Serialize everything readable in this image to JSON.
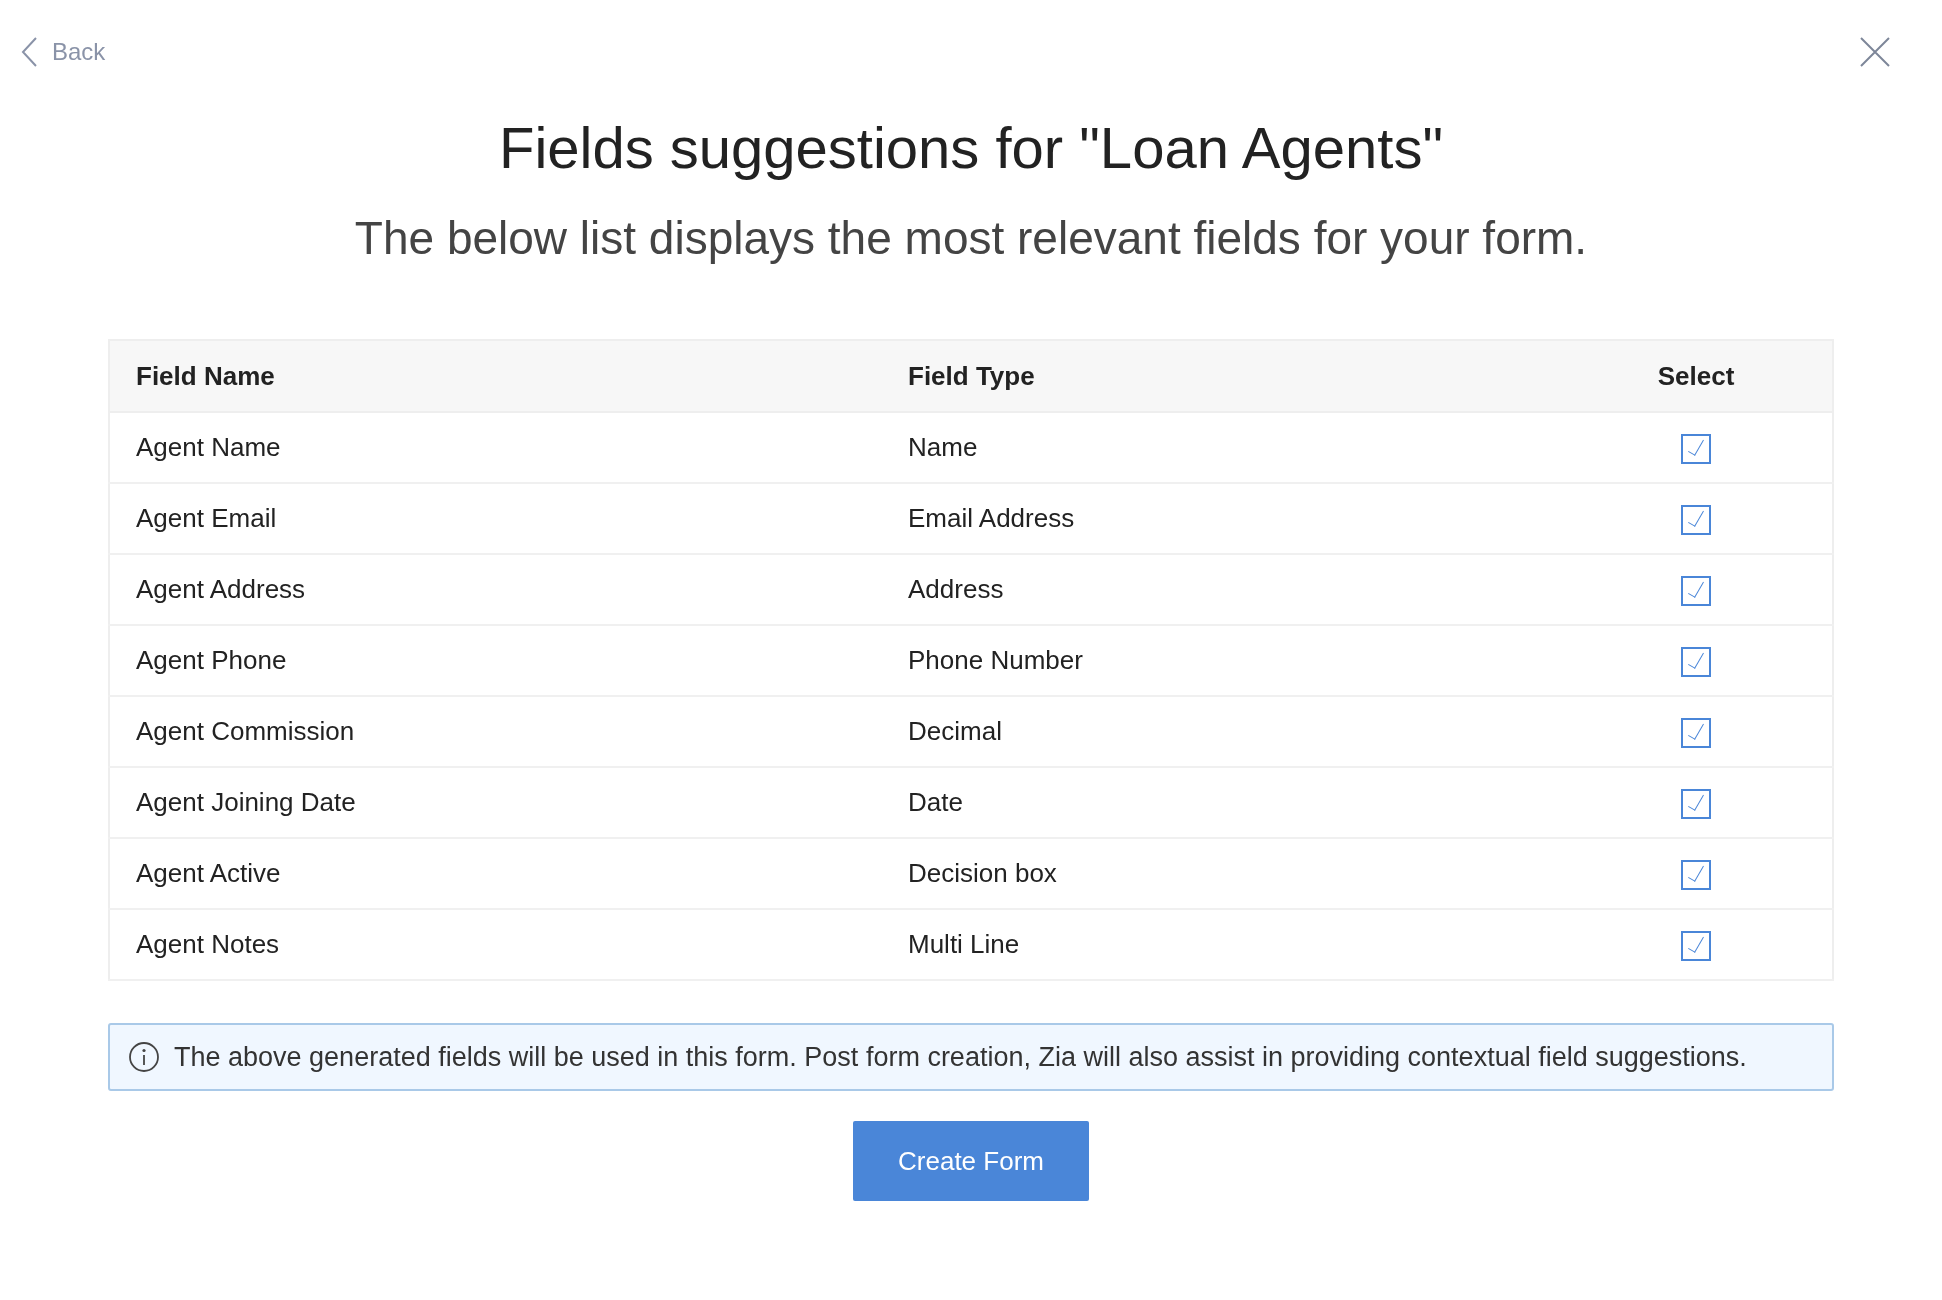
{
  "back": {
    "label": "Back"
  },
  "title": "Fields suggestions for \"Loan Agents\"",
  "subtitle": "The below list displays the most relevant fields for your form.",
  "table": {
    "columns": [
      "Field Name",
      "Field Type",
      "Select"
    ],
    "rows": [
      {
        "name": "Agent Name",
        "type": "Name",
        "checked": true
      },
      {
        "name": "Agent Email",
        "type": "Email Address",
        "checked": true
      },
      {
        "name": "Agent Address",
        "type": "Address",
        "checked": true
      },
      {
        "name": "Agent Phone",
        "type": "Phone Number",
        "checked": true
      },
      {
        "name": "Agent Commission",
        "type": "Decimal",
        "checked": true
      },
      {
        "name": "Agent Joining Date",
        "type": "Date",
        "checked": true
      },
      {
        "name": "Agent Active",
        "type": "Decision box",
        "checked": true
      },
      {
        "name": "Agent Notes",
        "type": "Multi Line",
        "checked": true
      }
    ]
  },
  "info": "The above generated fields will be used in this form. Post form creation, Zia will also assist in providing contextual field suggestions.",
  "button": "Create Form"
}
